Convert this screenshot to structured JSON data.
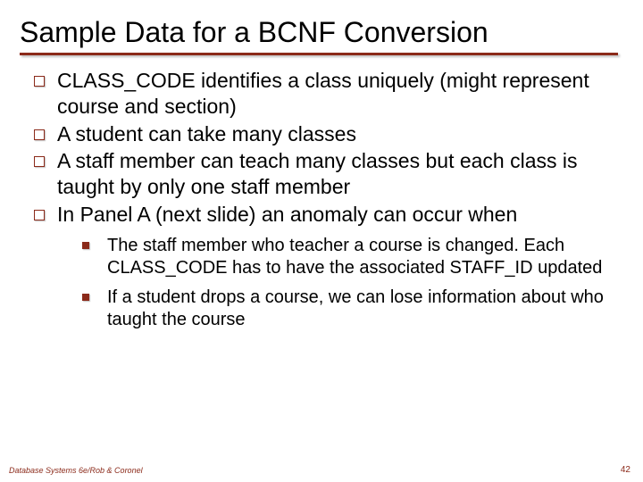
{
  "title": "Sample Data for a BCNF Conversion",
  "bullets": [
    "CLASS_CODE identifies a class uniquely (might represent course and section)",
    "A student can take many classes",
    "A staff member can teach many classes but each class is taught by only one staff member",
    "In Panel A (next slide) an anomaly can occur when"
  ],
  "subbullets": [
    "The staff member who teacher a course is changed. Each CLASS_CODE has to have the associated STAFF_ID updated",
    "If a student drops a course, we can lose information about who taught the course"
  ],
  "footer": {
    "left": "Database Systems 6e/Rob & Coronel",
    "right": "42"
  }
}
